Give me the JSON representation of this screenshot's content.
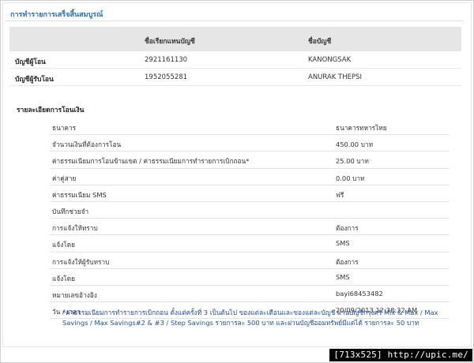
{
  "page_title": "การทำรายการเสร็จสิ้นสมบูรณ์",
  "accounts": {
    "header": {
      "alias": "ชื่อเรียกแทนบัญชี",
      "name": "ชื่อบัญชี"
    },
    "rows": [
      {
        "label": "บัญชีผู้โอน",
        "number": "2921161130",
        "name": "KANONGSAK"
      },
      {
        "label": "บัญชีผู้รับโอน",
        "number": "1952055281",
        "name": "ANURAK THEPSI"
      }
    ]
  },
  "details_title": "รายละเอียดการโอนเงิน",
  "details": [
    {
      "label": "ธนาคาร",
      "value": "ธนาคารทหารไทย"
    },
    {
      "label": "จำนวนเงินที่ต้องการโอน",
      "value": "450.00 บาท"
    },
    {
      "label": "ค่าธรรมเนียมการโอนข้ามเขต / ค่าธรรมเนียมการทำรายการเบิกถอน",
      "required_mark": "*",
      "value": "25.00 บาท"
    },
    {
      "label": "ค่าคู่สาย",
      "value": "0.00 บาท"
    },
    {
      "label": "ค่าธรรมเนียม SMS",
      "value": "ฟรี"
    },
    {
      "label": "บันทึกช่วยจำ",
      "value": ""
    },
    {
      "label": "การแจ้งให้ทราบ",
      "value": "ต้องการ"
    },
    {
      "label": "แจ้งโดย",
      "value": "SMS"
    },
    {
      "label": "การแจ้งให้ผู้รับทราบ",
      "value": "ต้องการ"
    },
    {
      "label": "แจ้งโดย",
      "value": "SMS"
    },
    {
      "label": "หมายเลขอ้างอิง",
      "value": "bayi68453482"
    },
    {
      "label": "วัน / เวลา",
      "value": "20/09/2013 12:38:32 AM"
    }
  ],
  "footnote": "*ค่าธรรมเนียมการทำรายการเบิกถอน ตั้งแต่ครั้งที่ 3 เป็นต้นไป ของแต่ละเดือนและของแต่ละบัญชี ผ่านบัญชีกรุงศรี Mix & Max / Max Savings / Max Savings#2 & #3 / Step Savings รายการละ 500 บาท และผ่านบัญชีออมทรัพย์มีแต่ได้ รายการละ 50 บาท",
  "watermark": "[713x525] http://upic.me/"
}
